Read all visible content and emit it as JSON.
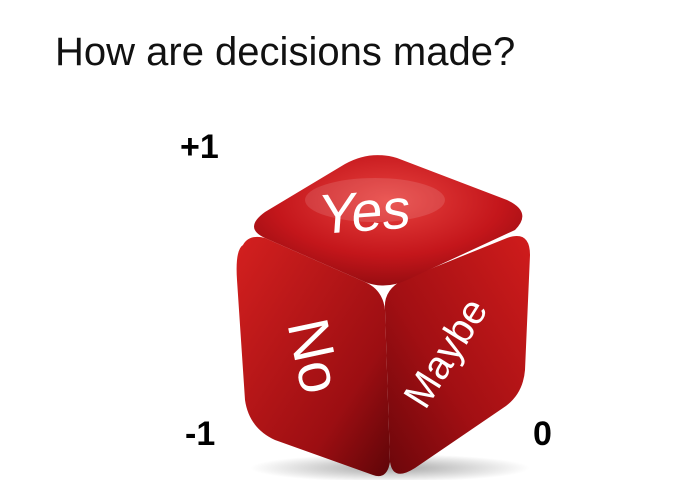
{
  "slide": {
    "title": "How are decisions made?"
  },
  "labels": {
    "plus_one": "+1",
    "minus_one": "-1",
    "zero": "0"
  },
  "dice": {
    "top_face": "Yes",
    "left_face": "No",
    "right_face": "Maybe",
    "color": "#c8141a"
  }
}
